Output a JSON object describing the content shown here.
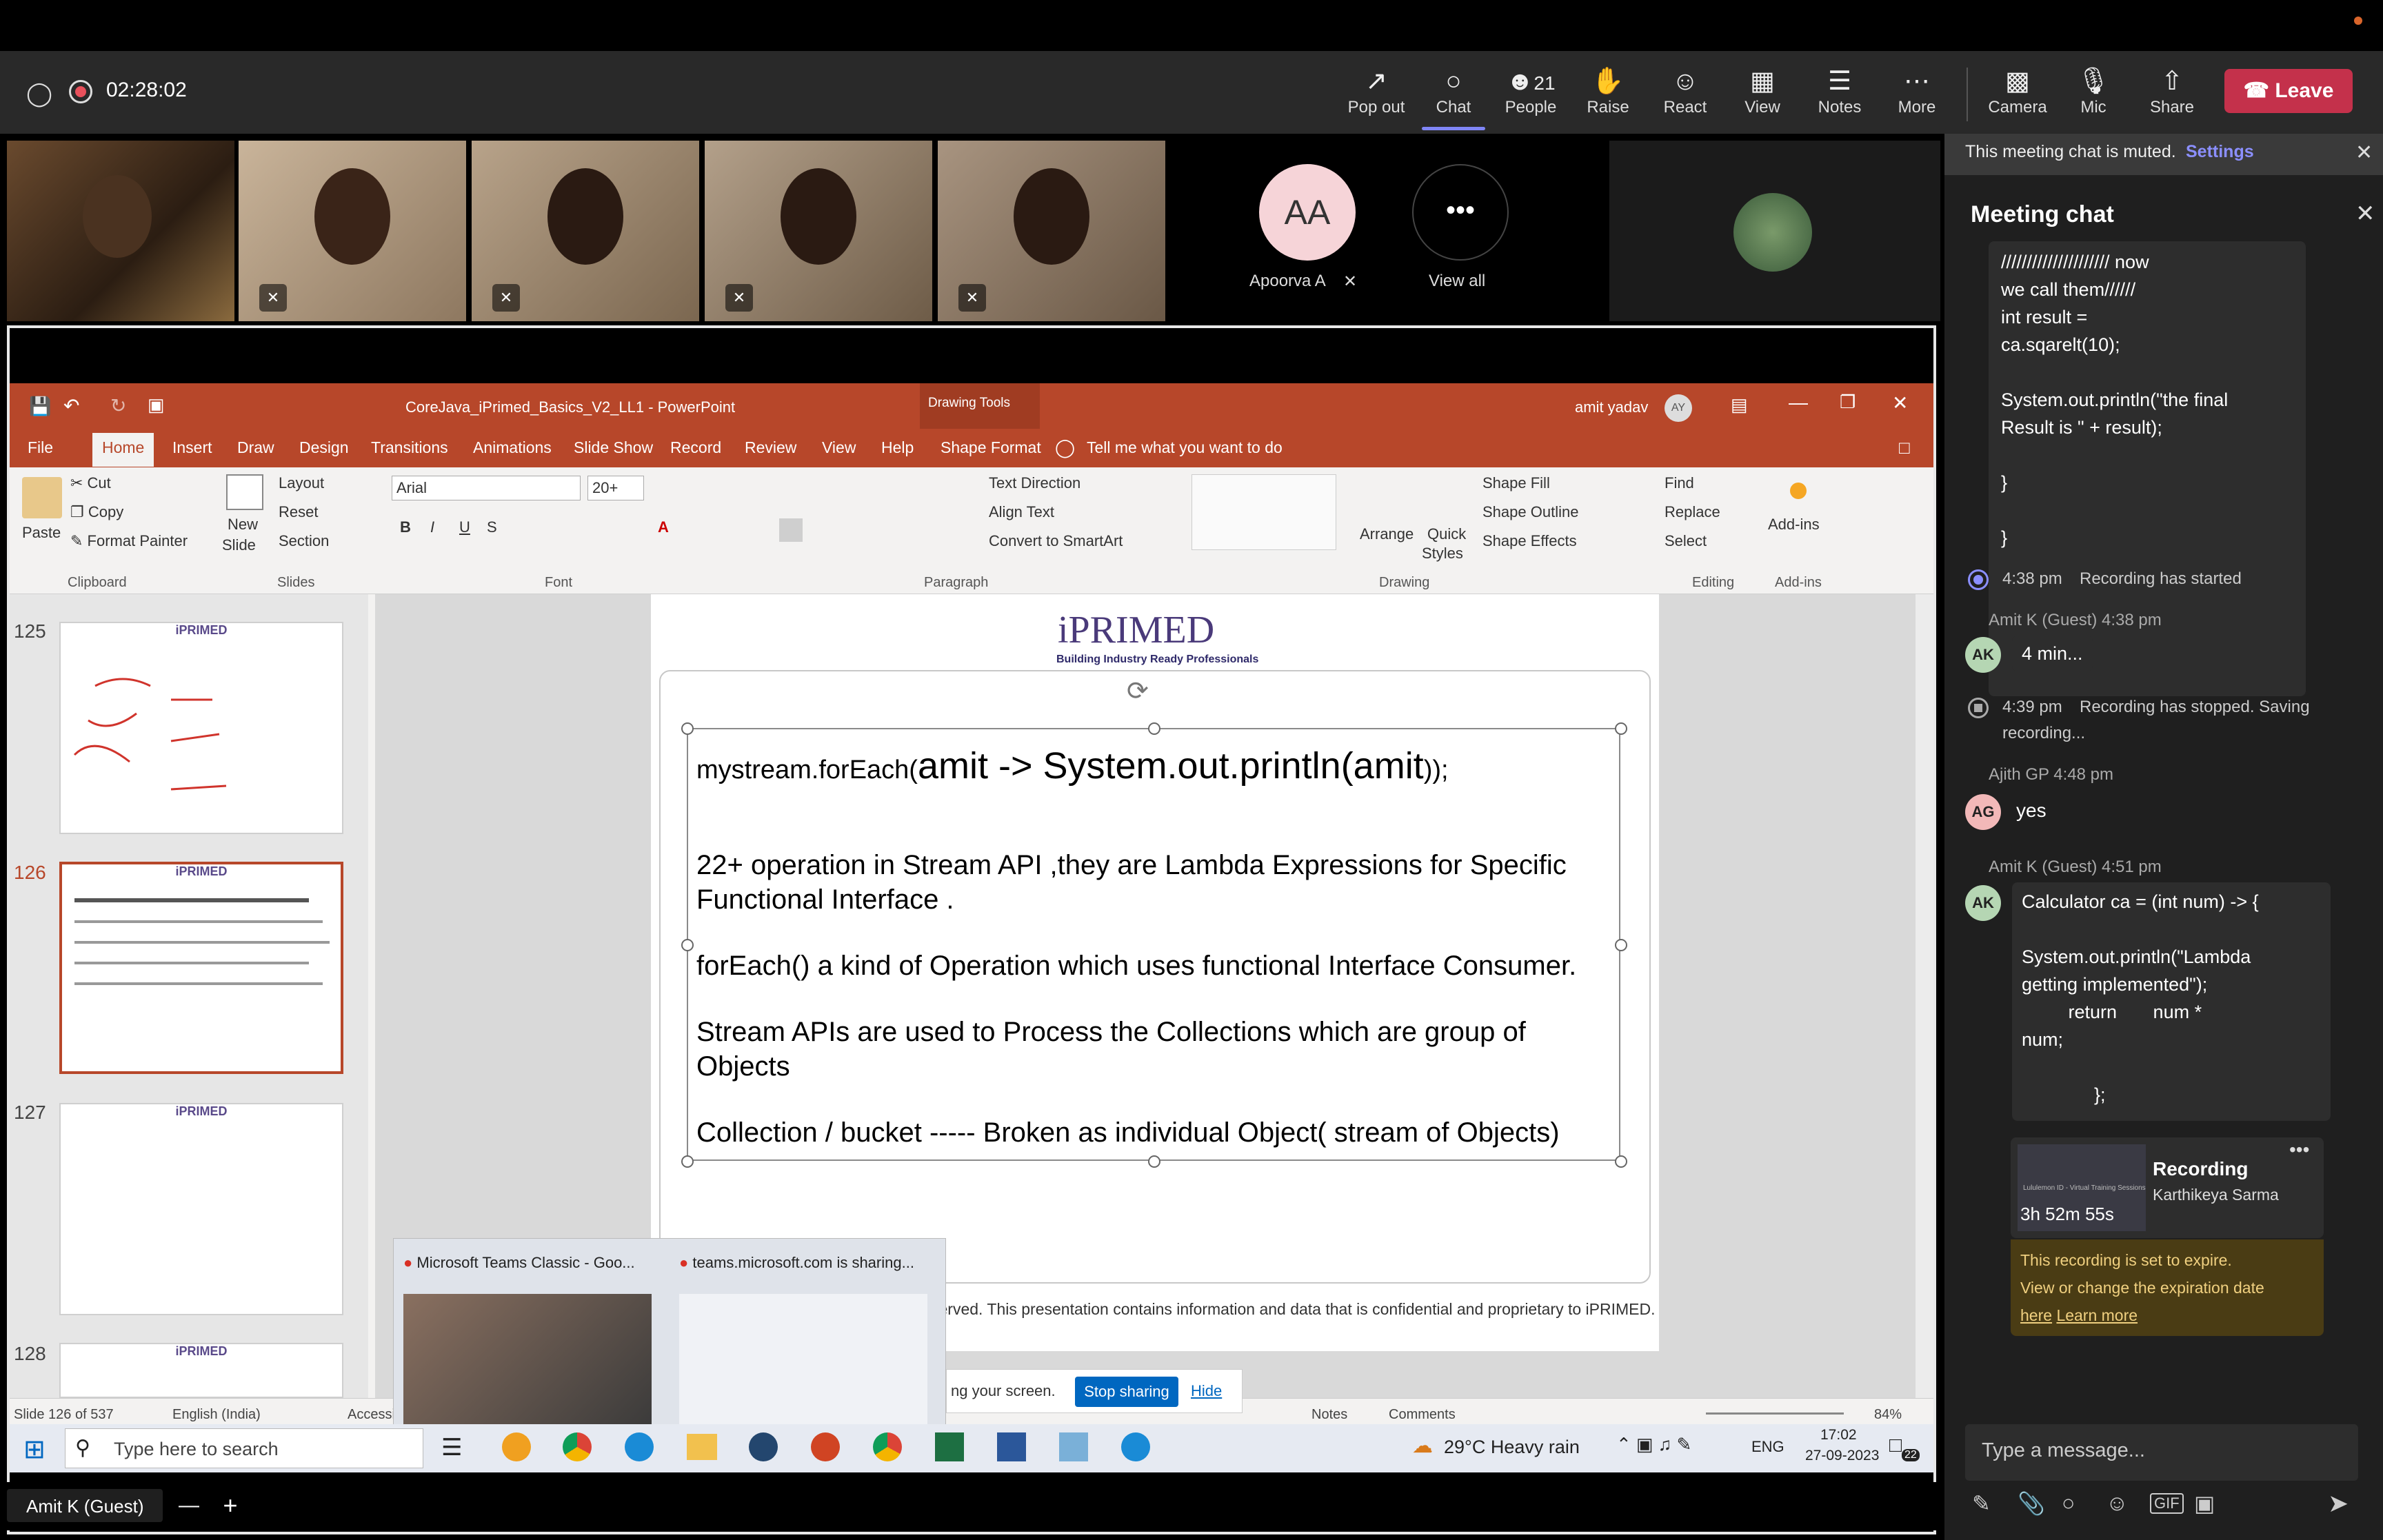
{
  "meeting": {
    "timer": "02:28:02"
  },
  "toolbar": {
    "popout": "Pop out",
    "chat": "Chat",
    "people": "People",
    "people_count": "21",
    "raise": "Raise",
    "react": "React",
    "view": "View",
    "notes": "Notes",
    "more": "More",
    "camera": "Camera",
    "mic": "Mic",
    "share": "Share",
    "leave": "Leave"
  },
  "participants": {
    "apoorva_initials": "AA",
    "apoorva_name": "Apoorva A",
    "view_all": "View all",
    "view_all_glyph": "•••"
  },
  "chat": {
    "muted_notice": "This meeting chat is muted.",
    "settings_link": "Settings",
    "title": "Meeting chat",
    "msg1_lines": [
      "///////////////////// now",
      "we call them//////",
      "int result =",
      "ca.sqarelt(10);",
      "",
      "System.out.println(\"the final",
      "Result is \" + result);",
      "",
      "}",
      "",
      "}"
    ],
    "recording_started_time": "4:38 pm",
    "recording_started": "Recording has started",
    "amit1_header": "Amit K (Guest)  4:38 pm",
    "amit_initials": "AK",
    "amit1_msg": "4 min...",
    "recording_stopped_time": "4:39 pm",
    "recording_stopped": "Recording has stopped. Saving",
    "recording_stopped2": "recording...",
    "ajith_header": "Ajith GP  4:48 pm",
    "ajith_initials": "AG",
    "ajith_msg": "yes",
    "amit2_header": "Amit K (Guest)  4:51 pm",
    "amit2_lines": [
      "Calculator ca = (int num) -> {",
      "",
      "System.out.println(\"Lambda",
      "getting implemented\");",
      "         return       num *",
      "num;",
      "",
      "              };"
    ],
    "rec_card_title": "Recording",
    "rec_card_author": "Karthikeya Sarma",
    "rec_card_duration": "3h 52m 55s",
    "rec_card_thumb_caption": "Lululemon ID - Virtual Training Sessions",
    "rec_card_more": "•••",
    "expire_line1": "This recording is set to expire.",
    "expire_line2": "View or change the expiration date",
    "expire_here": "here",
    "expire_learn": "Learn more",
    "compose_placeholder": "Type a message..."
  },
  "ppt": {
    "title": "CoreJava_iPrimed_Basics_V2_LL1 - PowerPoint",
    "drawing_tools": "Drawing Tools",
    "user": "amit yadav",
    "user_initials": "AY",
    "tabs": [
      "File",
      "Home",
      "Insert",
      "Draw",
      "Design",
      "Transitions",
      "Animations",
      "Slide Show",
      "Record",
      "Review",
      "View",
      "Help",
      "Shape Format"
    ],
    "tell_me": "Tell me what you want to do",
    "ribbon": {
      "paste": "Paste",
      "cut": "Cut",
      "copy": "Copy",
      "format_painter": "Format Painter",
      "clipboard": "Clipboard",
      "new_slide_1": "New",
      "new_slide_2": "Slide",
      "layout": "Layout",
      "reset": "Reset",
      "section": "Section",
      "slides": "Slides",
      "font_name": "Arial",
      "font_size": "20+",
      "font": "Font",
      "text_direction": "Text Direction",
      "align_text": "Align Text",
      "convert_smartart": "Convert to SmartArt",
      "paragraph": "Paragraph",
      "arrange": "Arrange",
      "quick_styles_1": "Quick",
      "quick_styles_2": "Styles",
      "shape_fill": "Shape Fill",
      "shape_outline": "Shape Outline",
      "shape_effects": "Shape Effects",
      "drawing": "Drawing",
      "find": "Find",
      "replace": "Replace",
      "select": "Select",
      "editing": "Editing",
      "addins": "Add-ins",
      "addins_group": "Add-ins"
    },
    "thumb_numbers": [
      "125",
      "126",
      "127",
      "128"
    ],
    "thumb_logo": "iPRIMED",
    "slide": {
      "logo": "iPRIMED",
      "tagline": "Building Industry Ready Professionals",
      "line1_small": "mystream.forEach(",
      "line1_big": "amit -> System.out.println(amit",
      "line1_end": "));",
      "para1": "22+ operation in Stream API ,they are Lambda Expressions for Specific Functional Interface .",
      "para2": "forEach() a kind of Operation which uses functional Interface Consumer.",
      "para3": "Stream APIs are used to Process the Collections which are group of Objects",
      "para4": "Collection / bucket ----- Broken as individual Object( stream of Objects)",
      "footer": "served. This presentation contains information  and data  that is confidential and proprietary to iPRIMED."
    },
    "status": {
      "slide_count": "Slide 126 of 537",
      "language": "English (India)",
      "accessibility": "Accessi",
      "notes": "Notes",
      "comments": "Comments",
      "zoom": "84%"
    }
  },
  "sharing_bar": {
    "text": "ng your screen.",
    "stop": "Stop sharing",
    "hide": "Hide"
  },
  "chrome_popup": {
    "item1": "Microsoft Teams Classic - Goo...",
    "item2": "teams.microsoft.com is sharing..."
  },
  "taskbar": {
    "search_placeholder": "Type here to search",
    "weather": "29°C  Heavy rain",
    "lang": "ENG",
    "time": "17:02",
    "date": "27-09-2023",
    "notif_count": "22"
  },
  "presenter": {
    "name": "Amit K (Guest)"
  },
  "colors": {
    "teams_accent": "#7f85f5",
    "leave_red": "#c4314b",
    "ppt_orange": "#b7472a",
    "stop_sharing_blue": "#0067c0"
  }
}
